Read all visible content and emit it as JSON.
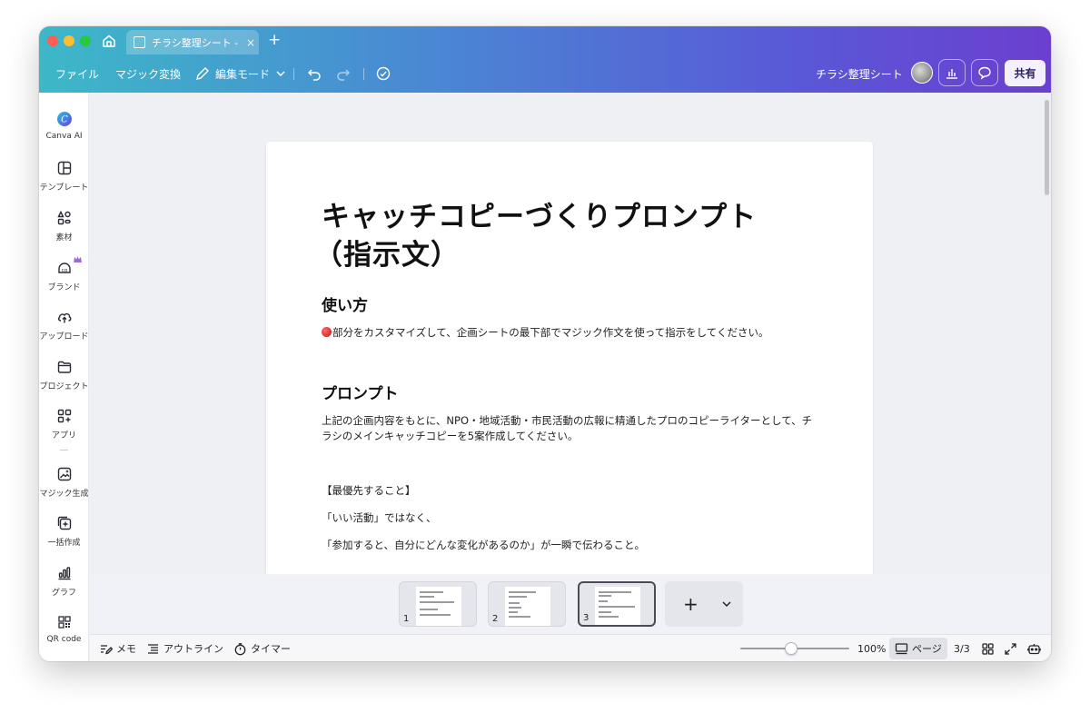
{
  "tab": {
    "title": "チラシ整理シート - ...",
    "close": "×",
    "new": "+"
  },
  "toolbar": {
    "file": "ファイル",
    "magic_convert": "マジック変換",
    "edit_mode": "編集モード",
    "doc_name": "チラシ整理シート",
    "share": "共有"
  },
  "sidebar": {
    "items": [
      {
        "label": "Canva AI",
        "icon": "canva-ai-icon"
      },
      {
        "label": "テンプレート",
        "icon": "template-icon"
      },
      {
        "label": "素材",
        "icon": "elements-icon"
      },
      {
        "label": "ブランド",
        "icon": "brand-icon"
      },
      {
        "label": "アップロード",
        "icon": "upload-icon"
      },
      {
        "label": "プロジェクト",
        "icon": "folder-icon"
      },
      {
        "label": "アプリ",
        "icon": "apps-icon"
      },
      {
        "label": "マジック生成",
        "icon": "magic-media-icon"
      },
      {
        "label": "一括作成",
        "icon": "bulk-create-icon"
      },
      {
        "label": "グラフ",
        "icon": "chart-icon"
      },
      {
        "label": "QR code",
        "icon": "qr-code-icon"
      }
    ]
  },
  "document": {
    "title_line1": "キャッチコピーづくりプロンプト",
    "title_line2": "（指示文）",
    "usage_heading": "使い方",
    "usage_text": "部分をカスタマイズして、企画シートの最下部でマジック作文を使って指示をしてください。",
    "prompt_heading": "プロンプト",
    "prompt_text": "上記の企画内容をもとに、NPO・地域活動・市民活動の広報に精通したプロのコピーライターとして、チラシのメインキャッチコピーを5案作成してください。",
    "priority_heading": "【最優先すること】",
    "line1": "「いい活動」ではなく、",
    "line2": "「参加すると、自分にどんな変化があるのか」が一瞬で伝わること。"
  },
  "pages": {
    "thumbnails": [
      {
        "num": "1"
      },
      {
        "num": "2"
      },
      {
        "num": "3",
        "active": true
      }
    ],
    "add": "+"
  },
  "footer": {
    "memo": "メモ",
    "outline": "アウトライン",
    "timer": "タイマー",
    "zoom": "100%",
    "zoom_fraction": 0.47,
    "page_view": "ページ",
    "page_count": "3/3"
  },
  "colors": {
    "header_start": "#3db8c8",
    "header_end": "#6b3fd0",
    "share_bg": "#f3f0ff"
  }
}
